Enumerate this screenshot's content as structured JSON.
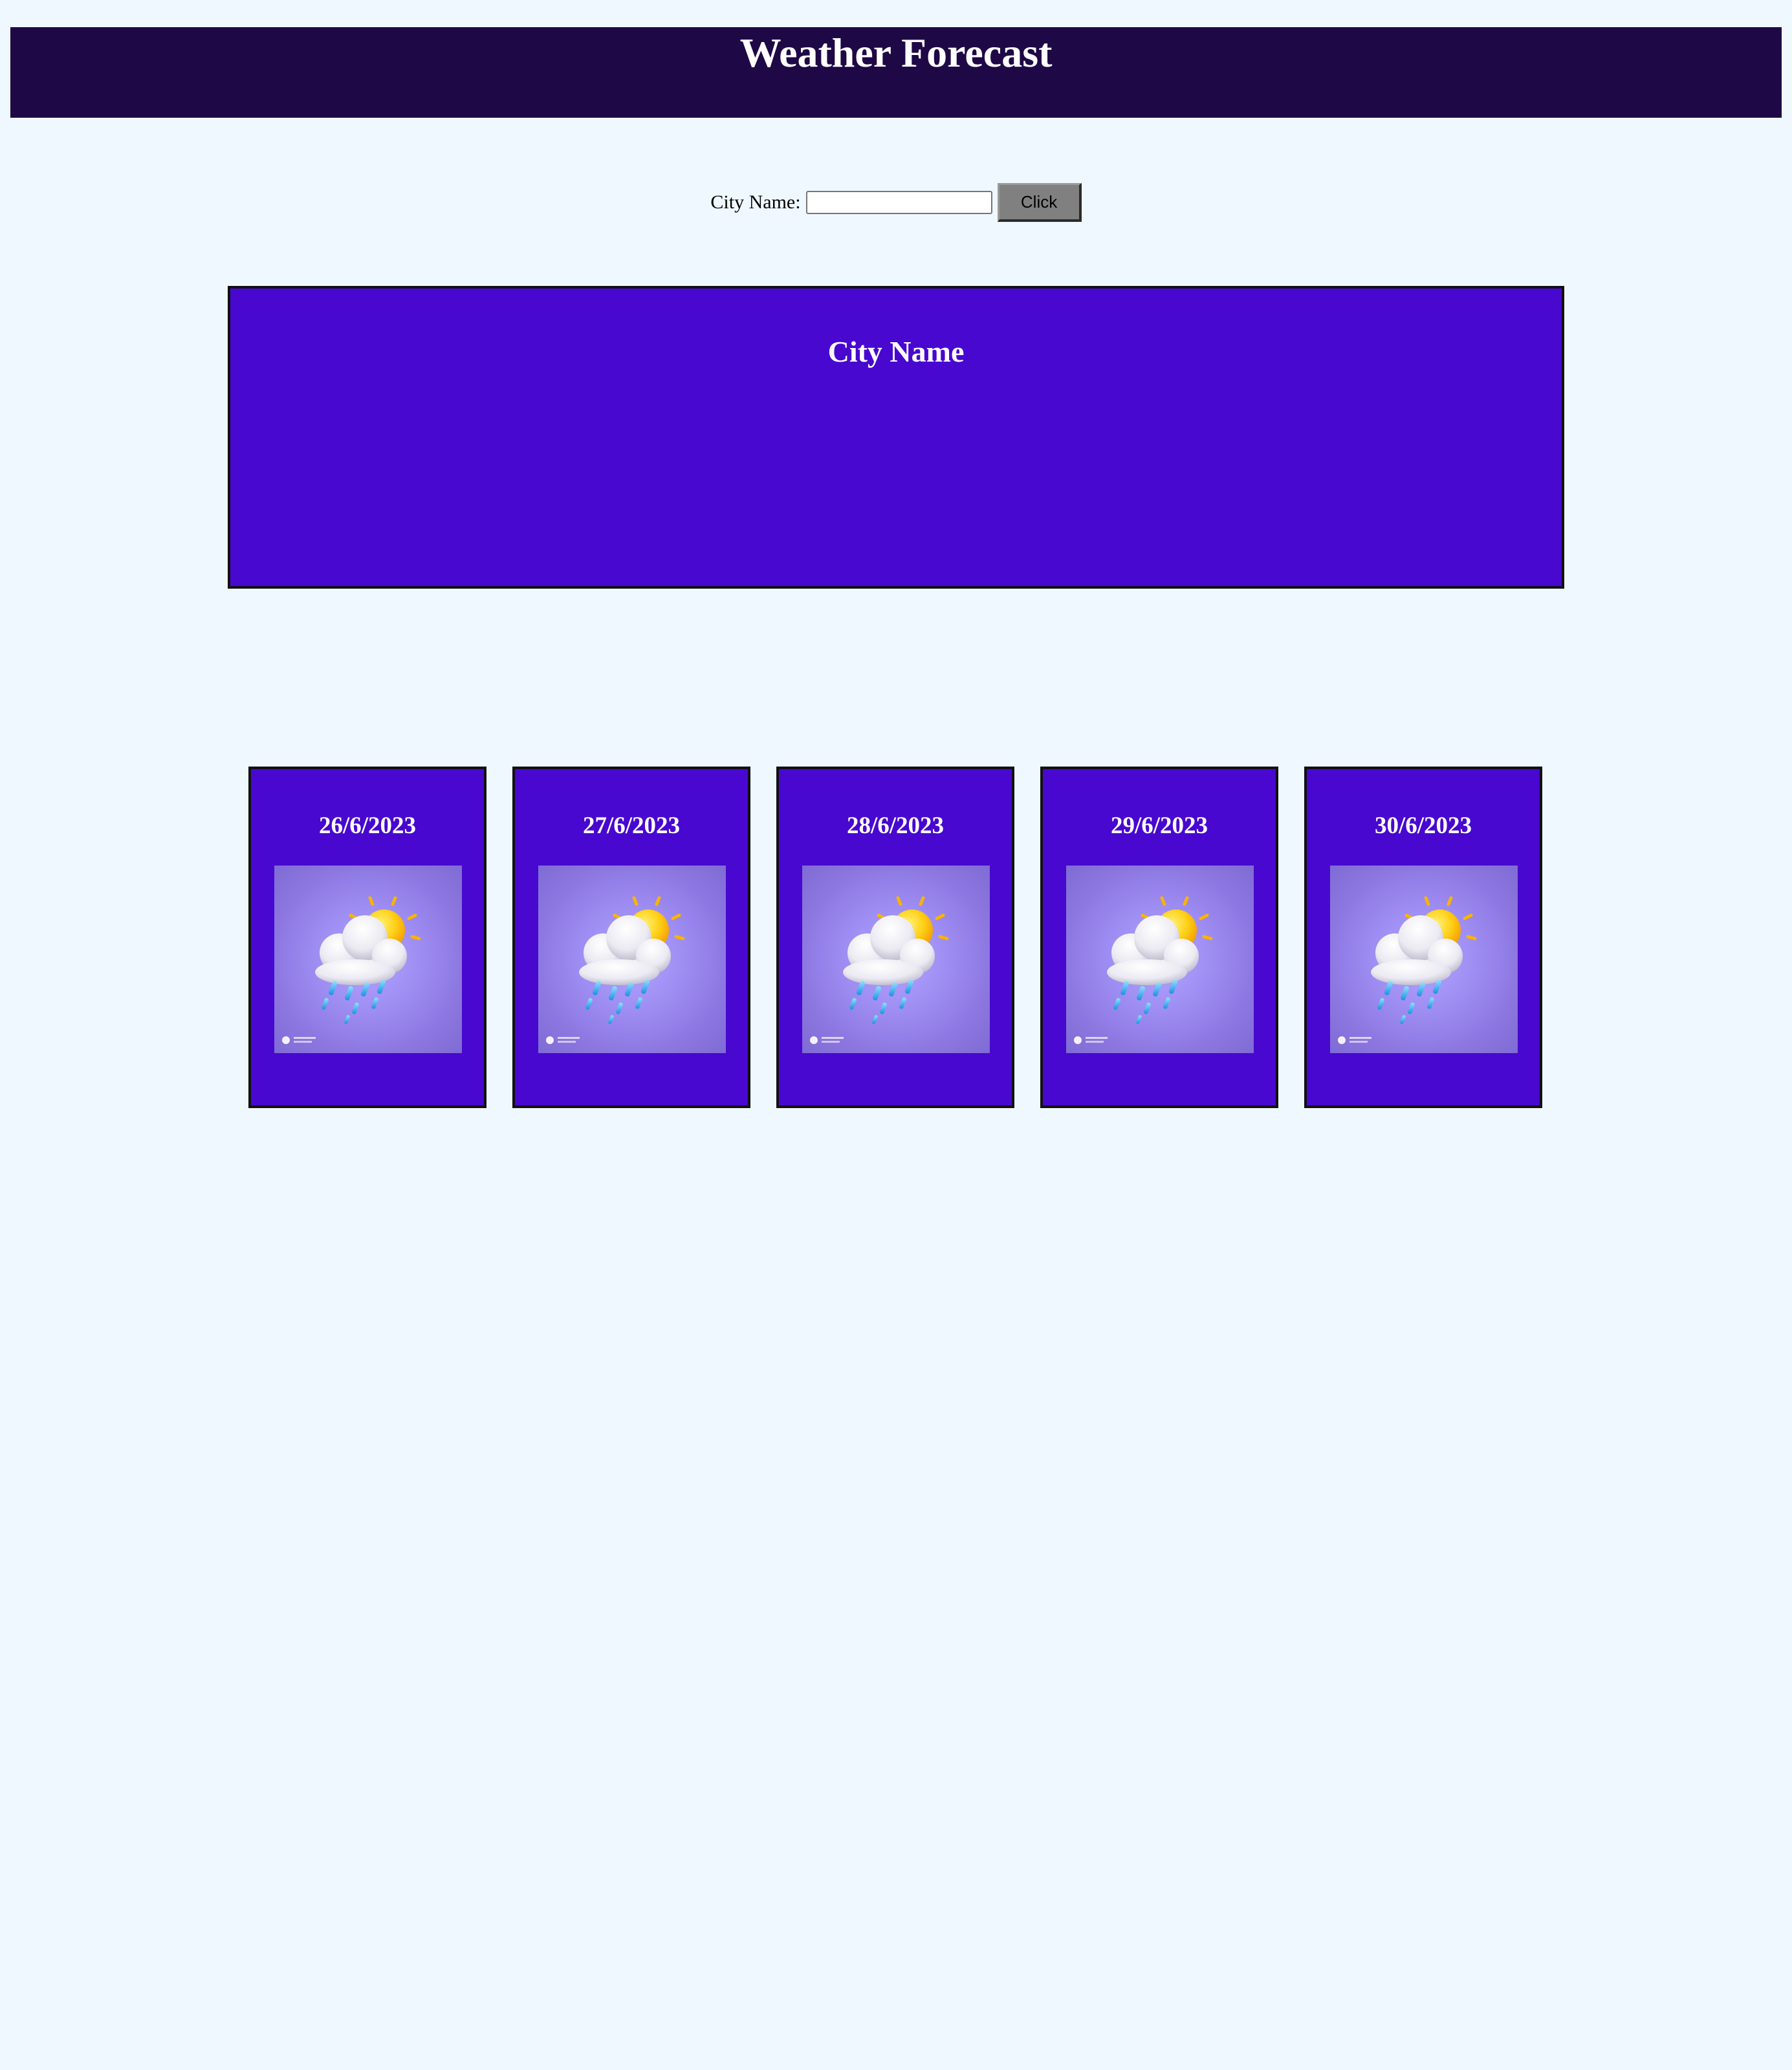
{
  "header": {
    "title": "Weather Forecast"
  },
  "search": {
    "label": "City Name:",
    "value": "",
    "placeholder": "",
    "button_label": "Click"
  },
  "current": {
    "city_title": "City Name"
  },
  "forecast": [
    {
      "date": "26/6/2023",
      "icon": "sun-cloud-rain-icon"
    },
    {
      "date": "27/6/2023",
      "icon": "sun-cloud-rain-icon"
    },
    {
      "date": "28/6/2023",
      "icon": "sun-cloud-rain-icon"
    },
    {
      "date": "29/6/2023",
      "icon": "sun-cloud-rain-icon"
    },
    {
      "date": "30/6/2023",
      "icon": "sun-cloud-rain-icon"
    }
  ],
  "colors": {
    "page_background": "#f0f8ff",
    "header_background": "#1e0845",
    "panel_background": "#4808cf",
    "button_background": "#808080"
  }
}
